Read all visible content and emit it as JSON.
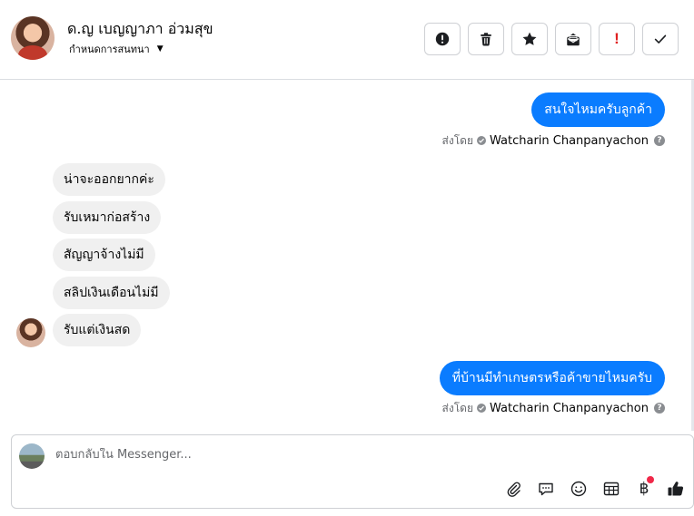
{
  "header": {
    "contact_name": "ด.ญ เบญญาภา อ่วมสุข",
    "assign_label": "กำหนดการสนทนา",
    "toolbar": [
      "alert-icon",
      "trash-icon",
      "star-icon",
      "mark-unread-icon",
      "exclamation-icon",
      "check-icon"
    ],
    "exclamation_glyph": "!"
  },
  "messages": [
    {
      "direction": "out",
      "text": "สนใจไหมครับลูกค้า"
    },
    {
      "direction": "in",
      "text": "น่าจะออกยากค่ะ"
    },
    {
      "direction": "in",
      "text": "รับเหมาก่อสร้าง"
    },
    {
      "direction": "in",
      "text": "สัญญาจ้างไม่มี"
    },
    {
      "direction": "in",
      "text": "สลิปเงินเดือนไม่มี"
    },
    {
      "direction": "in",
      "text": "รับแต่เงินสด"
    },
    {
      "direction": "out",
      "text": "ที่บ้านมีทำเกษตรหรือค้าขายไหมครับ"
    }
  ],
  "sent_by": {
    "prefix": "ส่งโดย",
    "agent": "Watcharin Chanpanyachon",
    "help_glyph": "?"
  },
  "composer": {
    "placeholder": "ตอบกลับใน Messenger...",
    "baht_glyph": "฿"
  },
  "colors": {
    "outgoing_bubble": "#0a7cff",
    "incoming_bubble": "#f0f0f0",
    "notification_dot": "#f02849",
    "exclamation": "#e02020"
  }
}
